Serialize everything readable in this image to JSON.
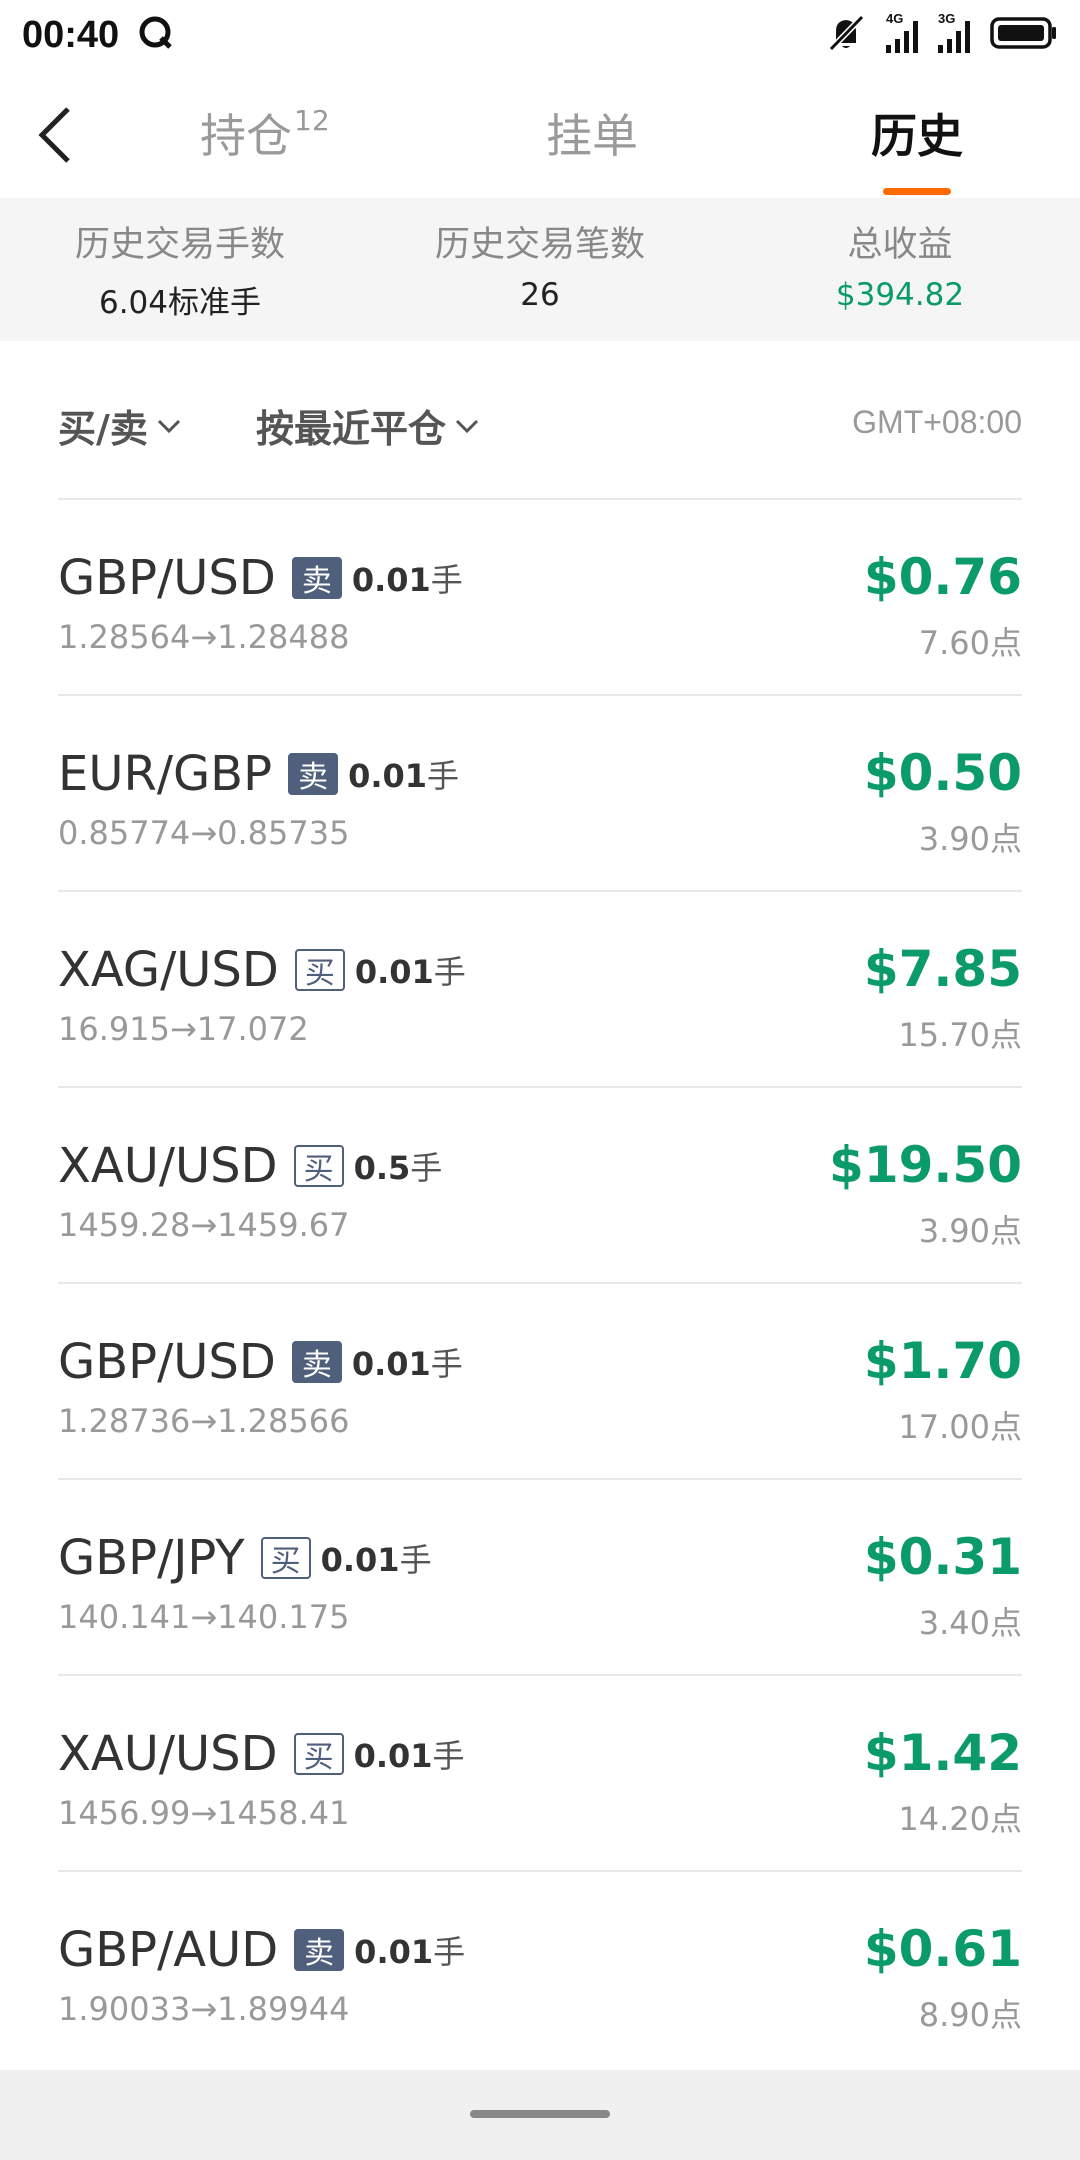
{
  "status_bar": {
    "time": "00:40",
    "signal1": "4G",
    "signal2": "3G"
  },
  "tabs": {
    "positions_label": "持仓",
    "positions_count": "12",
    "orders_label": "挂单",
    "history_label": "历史"
  },
  "summary": {
    "lots_label": "历史交易手数",
    "lots_value": "6.04标准手",
    "trades_label": "历史交易笔数",
    "trades_value": "26",
    "profit_label": "总收益",
    "profit_value": "$394.82"
  },
  "filters": {
    "side_label": "买/卖",
    "sort_label": "按最近平仓",
    "timezone": "GMT+08:00"
  },
  "colors": {
    "profit": "#0b9a6a",
    "accent": "#ff6a00",
    "tag": "#4f5f7c"
  },
  "trades": [
    {
      "symbol": "GBP/USD",
      "side": "卖",
      "lot": "0.01",
      "unit": "手",
      "prices": "1.28564→1.28488",
      "profit": "$0.76",
      "points": "7.60点"
    },
    {
      "symbol": "EUR/GBP",
      "side": "卖",
      "lot": "0.01",
      "unit": "手",
      "prices": "0.85774→0.85735",
      "profit": "$0.50",
      "points": "3.90点"
    },
    {
      "symbol": "XAG/USD",
      "side": "买",
      "lot": "0.01",
      "unit": "手",
      "prices": "16.915→17.072",
      "profit": "$7.85",
      "points": "15.70点"
    },
    {
      "symbol": "XAU/USD",
      "side": "买",
      "lot": "0.5",
      "unit": "手",
      "prices": "1459.28→1459.67",
      "profit": "$19.50",
      "points": "3.90点"
    },
    {
      "symbol": "GBP/USD",
      "side": "卖",
      "lot": "0.01",
      "unit": "手",
      "prices": "1.28736→1.28566",
      "profit": "$1.70",
      "points": "17.00点"
    },
    {
      "symbol": "GBP/JPY",
      "side": "买",
      "lot": "0.01",
      "unit": "手",
      "prices": "140.141→140.175",
      "profit": "$0.31",
      "points": "3.40点"
    },
    {
      "symbol": "XAU/USD",
      "side": "买",
      "lot": "0.01",
      "unit": "手",
      "prices": "1456.99→1458.41",
      "profit": "$1.42",
      "points": "14.20点"
    },
    {
      "symbol": "GBP/AUD",
      "side": "卖",
      "lot": "0.01",
      "unit": "手",
      "prices": "1.90033→1.89944",
      "profit": "$0.61",
      "points": "8.90点"
    }
  ]
}
